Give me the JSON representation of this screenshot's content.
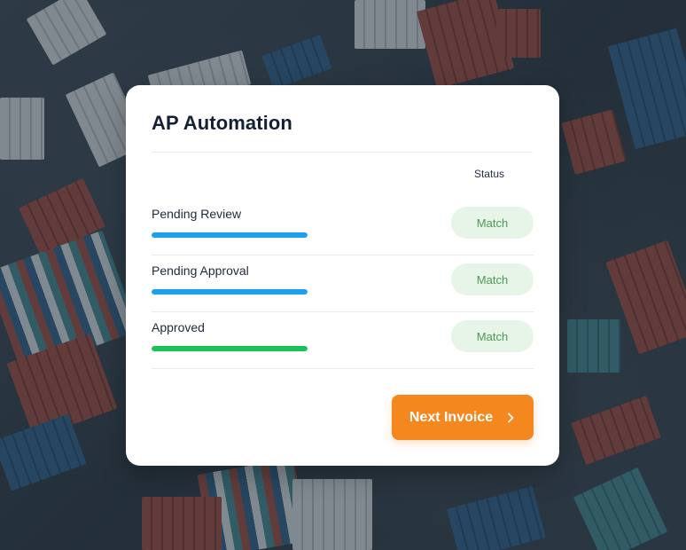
{
  "card": {
    "title": "AP Automation",
    "status_header": "Status",
    "rows": [
      {
        "label": "Pending Review",
        "status": "Match",
        "progress": 1.0,
        "bar_color": "#1ea0f0"
      },
      {
        "label": "Pending Approval",
        "status": "Match",
        "progress": 1.0,
        "bar_color": "#1ea0f0"
      },
      {
        "label": "Approved",
        "status": "Match",
        "progress": 1.0,
        "bar_color": "#19c257"
      }
    ],
    "next_button": {
      "label": "Next Invoice",
      "icon": "chevron-right-icon",
      "color": "#f5871f"
    }
  },
  "theme": {
    "match_text_color": "#4c9a5a",
    "match_bg_color": "#e7f4e8"
  }
}
